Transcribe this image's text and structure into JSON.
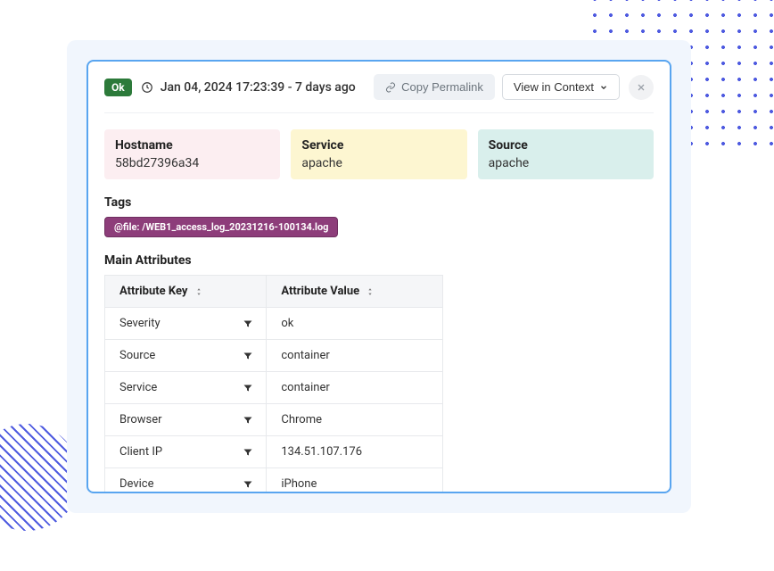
{
  "header": {
    "status": "Ok",
    "timestamp": "Jan 04, 2024 17:23:39 - 7 days ago",
    "copy_permalink_label": "Copy Permalink",
    "view_context_label": "View in Context"
  },
  "info": {
    "hostname_label": "Hostname",
    "hostname_value": "58bd27396a34",
    "service_label": "Service",
    "service_value": "apache",
    "source_label": "Source",
    "source_value": "apache"
  },
  "tags": {
    "title": "Tags",
    "pill": "@file: /WEB1_access_log_20231216-100134.log"
  },
  "attributes": {
    "title": "Main Attributes",
    "col_key": "Attribute Key",
    "col_value": "Attribute Value",
    "rows": [
      {
        "key": "Severity",
        "value": "ok"
      },
      {
        "key": "Source",
        "value": "container"
      },
      {
        "key": "Service",
        "value": "container"
      },
      {
        "key": "Browser",
        "value": "Chrome"
      },
      {
        "key": "Client IP",
        "value": "134.51.107.176"
      },
      {
        "key": "Device",
        "value": "iPhone"
      }
    ]
  }
}
